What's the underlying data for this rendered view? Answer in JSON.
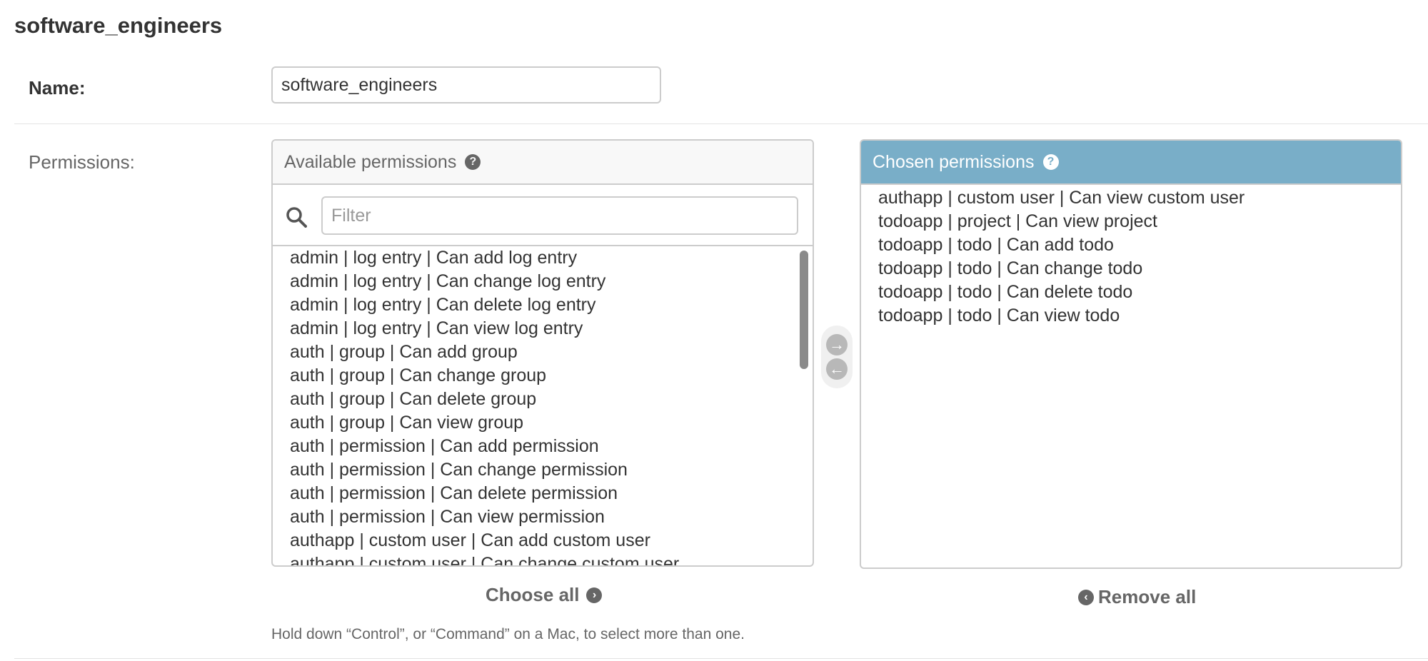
{
  "page": {
    "title": "software_engineers"
  },
  "name_field": {
    "label": "Name:",
    "value": "software_engineers"
  },
  "permissions": {
    "label": "Permissions:",
    "available": {
      "title": "Available permissions",
      "help_icon": "?",
      "filter_placeholder": "Filter",
      "options": [
        "admin | log entry | Can add log entry",
        "admin | log entry | Can change log entry",
        "admin | log entry | Can delete log entry",
        "admin | log entry | Can view log entry",
        "auth | group | Can add group",
        "auth | group | Can change group",
        "auth | group | Can delete group",
        "auth | group | Can view group",
        "auth | permission | Can add permission",
        "auth | permission | Can change permission",
        "auth | permission | Can delete permission",
        "auth | permission | Can view permission",
        "authapp | custom user | Can add custom user",
        "authapp | custom user | Can change custom user"
      ]
    },
    "chosen": {
      "title": "Chosen permissions",
      "help_icon": "?",
      "options": [
        "authapp | custom user | Can view custom user",
        "todoapp | project | Can view project",
        "todoapp | todo | Can add todo",
        "todoapp | todo | Can change todo",
        "todoapp | todo | Can delete todo",
        "todoapp | todo | Can view todo"
      ]
    },
    "arrows": {
      "add_glyph": "→",
      "remove_glyph": "←"
    },
    "choose_all_label": "Choose all",
    "choose_all_glyph": "›",
    "remove_all_label": "Remove all",
    "remove_all_glyph": "‹",
    "help_text": "Hold down “Control”, or “Command” on a Mac, to select more than one."
  },
  "colors": {
    "chosen_header_bg": "#79aec8",
    "border": "#cccccc",
    "muted_text": "#666666"
  }
}
